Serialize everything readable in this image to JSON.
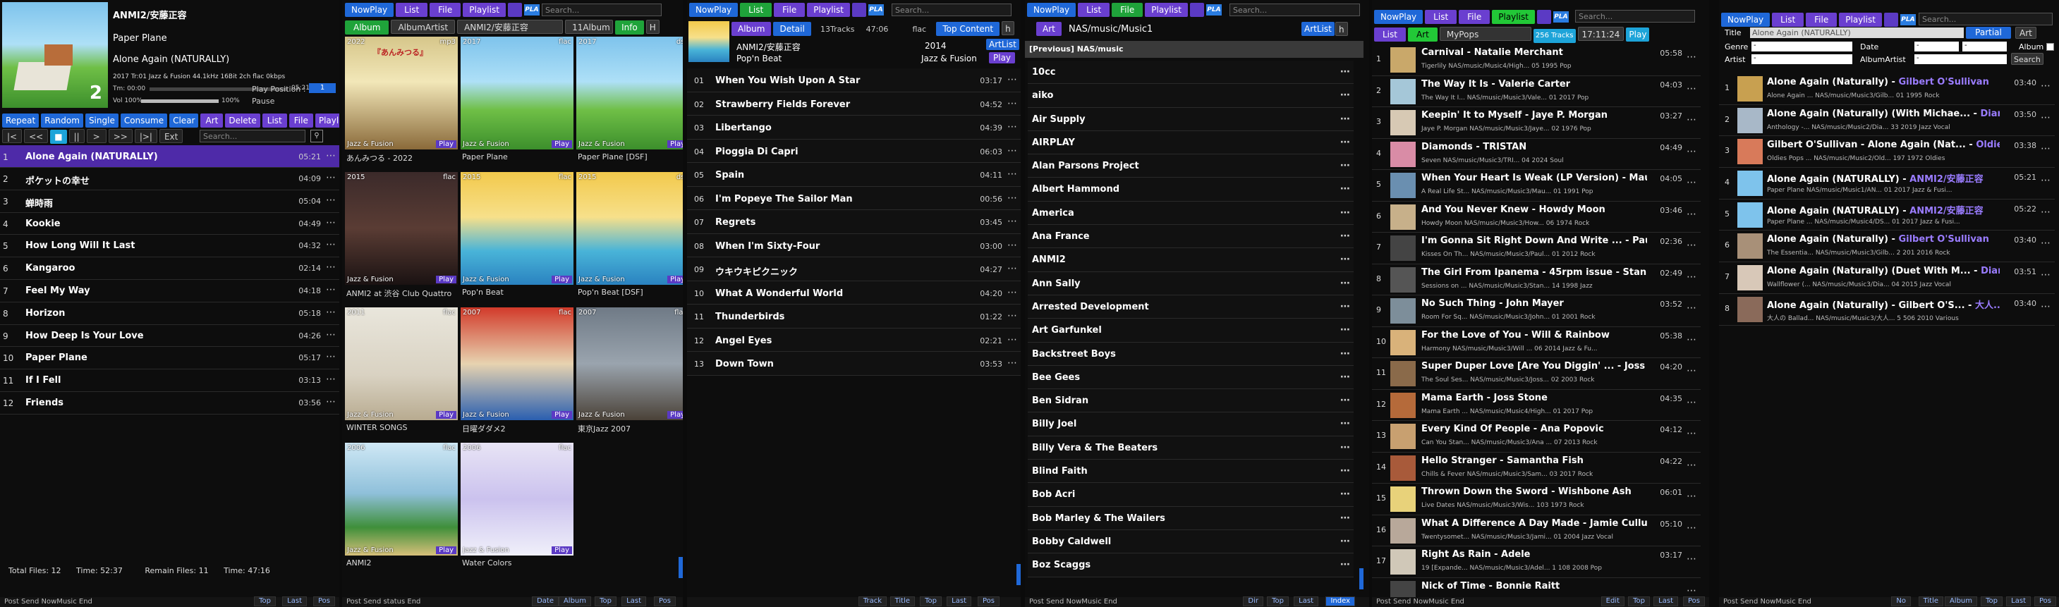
{
  "p1": {
    "now": {
      "artist": "ANMI2/安藤正容",
      "album": "Paper Plane",
      "title": "Alone Again (NATURALLY)",
      "info": "2017 Tr:01 Jazz & Fusion 44.1kHz 16Bit 2ch flac 0kbps",
      "time": "Tm: 00:00",
      "time_total": "05:21",
      "vol": "Vol 100%",
      "vol_pct": "100%",
      "pause": "Pause",
      "play_position_label": "Play Position :",
      "play_position_value": "1",
      "cover_number": "2",
      "progress": 0.0,
      "volume": 1.0
    },
    "mode_buttons": [
      "Repeat",
      "Random",
      "Single",
      "Consume",
      "Clear",
      "Art",
      "Delete",
      "List",
      "File",
      "Playlist"
    ],
    "transport": [
      "|<",
      "<<",
      "■",
      "||",
      ">",
      ">>",
      "|>|",
      "Ext"
    ],
    "search_placeholder": "Search...",
    "queue": [
      {
        "n": "1",
        "t": "Alone Again (NATURALLY)",
        "d": "05:21"
      },
      {
        "n": "2",
        "t": "ポケットの幸せ",
        "d": "04:09"
      },
      {
        "n": "3",
        "t": "蝉時雨",
        "d": "05:04"
      },
      {
        "n": "4",
        "t": "Kookie",
        "d": "04:49"
      },
      {
        "n": "5",
        "t": "How Long Will It Last",
        "d": "04:32"
      },
      {
        "n": "6",
        "t": "Kangaroo",
        "d": "02:14"
      },
      {
        "n": "7",
        "t": "Feel My Way",
        "d": "04:18"
      },
      {
        "n": "8",
        "t": "Horizon",
        "d": "05:18"
      },
      {
        "n": "9",
        "t": "How Deep Is Your Love",
        "d": "04:26"
      },
      {
        "n": "10",
        "t": "Paper Plane",
        "d": "05:17"
      },
      {
        "n": "11",
        "t": "If I Fell",
        "d": "03:13"
      },
      {
        "n": "12",
        "t": "Friends",
        "d": "03:56"
      }
    ],
    "status": {
      "total": "Total  Files:  12",
      "time": "Time:  52:37",
      "remain": "Remain  Files:  11",
      "rtime": "Time:  47:16"
    },
    "footer": {
      "label": "Post Send NowMusic End",
      "tabs": [
        "Top",
        "Last",
        "Pos"
      ]
    }
  },
  "p2": {
    "top_buttons": [
      "NowPlay",
      "List",
      "File",
      "Playlist"
    ],
    "tabs": [
      "Album",
      "AlbumArtist"
    ],
    "path": "ANMI2/安藤正容",
    "count": "11Album",
    "info_btn": "Info",
    "h_btn": "H",
    "search_placeholder": "Search...",
    "cover_text": "『あんみつる』",
    "tiles": [
      {
        "yr": "2022",
        "fmt": "mp3",
        "lbl": "Jazz & Fusion",
        "cap": "あんみつる - 2022"
      },
      {
        "yr": "2017",
        "fmt": "flac",
        "lbl": "Jazz & Fusion",
        "cap": "Paper Plane"
      },
      {
        "yr": "2017",
        "fmt": "dsf",
        "lbl": "Jazz & Fusion",
        "cap": "Paper Plane [DSF]"
      },
      {
        "yr": "2015",
        "fmt": "flac",
        "lbl": "Jazz & Fusion",
        "cap": "ANMI2 at 渋谷 Club Quattro"
      },
      {
        "yr": "2015",
        "fmt": "flac",
        "lbl": "Jazz & Fusion",
        "cap": "Pop'n Beat"
      },
      {
        "yr": "2015",
        "fmt": "dsf",
        "lbl": "Jazz & Fusion",
        "cap": "Pop'n Beat [DSF]"
      },
      {
        "yr": "2011",
        "fmt": "flac",
        "lbl": "Jazz & Fusion",
        "cap": "WINTER SONGS"
      },
      {
        "yr": "2007",
        "fmt": "flac",
        "lbl": "Jazz & Fusion",
        "cap": "日曜ダダメ2"
      },
      {
        "yr": "2007",
        "fmt": "flac",
        "lbl": "Jazz & Fusion",
        "cap": "東京Jazz 2007"
      },
      {
        "yr": "2006",
        "fmt": "flac",
        "lbl": "Jazz & Fusion",
        "cap": "ANMI2"
      },
      {
        "yr": "2006",
        "fmt": "flac",
        "lbl": "Jazz & Fusion",
        "cap": "Water Colors"
      }
    ],
    "play_label": "Play",
    "footer": {
      "label": "Post Send status End",
      "tabs": [
        "Date",
        "Album",
        "Top",
        "Last",
        "Pos"
      ]
    }
  },
  "p3": {
    "top_buttons": [
      "NowPlay",
      "List",
      "File",
      "Playlist"
    ],
    "tabs": [
      "Album",
      "Detail"
    ],
    "tracks": "13Tracks",
    "length": "47:06",
    "fmt": "flac",
    "top_content": "Top Content",
    "h": "h",
    "search_placeholder": "Search...",
    "artist": "ANMI2/安藤正容",
    "year": "2014",
    "album": "Pop'n Beat",
    "genre": "Jazz & Fusion",
    "artlist": "ArtList",
    "play": "Play",
    "list": [
      {
        "n": "01",
        "t": "When You Wish Upon A Star",
        "d": "03:17"
      },
      {
        "n": "02",
        "t": "Strawberry Fields Forever",
        "d": "04:52"
      },
      {
        "n": "03",
        "t": "Libertango",
        "d": "04:39"
      },
      {
        "n": "04",
        "t": "Pioggia Di Capri",
        "d": "06:03"
      },
      {
        "n": "05",
        "t": "Spain",
        "d": "04:11"
      },
      {
        "n": "06",
        "t": "I'm Popeye The Sailor Man",
        "d": "00:56"
      },
      {
        "n": "07",
        "t": "Regrets",
        "d": "03:45"
      },
      {
        "n": "08",
        "t": "When I'm Sixty-Four",
        "d": "03:00"
      },
      {
        "n": "09",
        "t": "ウキウキピクニック",
        "d": "04:27"
      },
      {
        "n": "10",
        "t": "What A Wonderful World",
        "d": "04:20"
      },
      {
        "n": "11",
        "t": "Thunderbirds",
        "d": "01:22"
      },
      {
        "n": "12",
        "t": "Angel Eyes",
        "d": "02:21"
      },
      {
        "n": "13",
        "t": "Down Town",
        "d": "03:53"
      }
    ],
    "footer": {
      "label": "",
      "tabs": [
        "Track",
        "Title",
        "Top",
        "Last",
        "Pos"
      ]
    }
  },
  "p4": {
    "top_buttons": [
      "NowPlay",
      "List",
      "File",
      "Playlist"
    ],
    "art": "Art",
    "path": "NAS/music/Music1",
    "artlist": "ArtList",
    "h": "h",
    "search_placeholder": "Search...",
    "prev": "[Previous] NAS/music",
    "list": [
      "10cc",
      "aiko",
      "Air Supply",
      "AIRPLAY",
      "Alan Parsons Project",
      "Albert Hammond",
      "America",
      "Ana France",
      "ANMI2",
      "Ann Sally",
      "Arrested Development",
      "Art Garfunkel",
      "Backstreet Boys",
      "Bee Gees",
      "Ben Sidran",
      "Billy Joel",
      "Billy Vera & The Beaters",
      "Blind Faith",
      "Bob Acri",
      "Bob Marley & The Wailers",
      "Bobby Caldwell",
      "Boz Scaggs"
    ],
    "footer": {
      "label": "Post Send NowMusic End",
      "tabs": [
        "Dir",
        "Top",
        "Last",
        "Index"
      ]
    }
  },
  "p5": {
    "top_buttons": [
      "NowPlay",
      "List",
      "File",
      "Playlist"
    ],
    "list_btn": "List",
    "art_btn": "Art",
    "name": "MyPops",
    "tracks": "256 Tracks",
    "time": "17:11:24",
    "play": "Play",
    "search_placeholder": "Search...",
    "rows": [
      {
        "n": "1",
        "t": "Carnival - Natalie Merchant",
        "s": "Tigerlily       NAS/music/Music4/High...   05    1995 Pop",
        "d": "05:58"
      },
      {
        "n": "2",
        "t": "The Way It Is - Valerie Carter",
        "s": "The Way It I...   NAS/music/Music3/Vale...   01    2017 Pop",
        "d": "04:03"
      },
      {
        "n": "3",
        "t": "Keepin' It to Myself - Jaye P. Morgan",
        "s": "Jaye P. Morgan   NAS/music/Music3/Jaye...   02    1976 Pop",
        "d": "03:27"
      },
      {
        "n": "4",
        "t": "Diamonds - TRISTAN",
        "s": "Seven       NAS/music/Music3/TRI...   04    2024 Soul",
        "d": "04:49"
      },
      {
        "n": "5",
        "t": "When Your Heart Is Weak (LP Version) - Maura ...",
        "s": "A Real Life St...   NAS/music/Music3/Mau...   01    1991 Pop",
        "d": "04:05"
      },
      {
        "n": "6",
        "t": "And You Never Knew - Howdy Moon",
        "s": "Howdy Moon   NAS/music/Music3/How...   06    1974 Rock",
        "d": "03:46"
      },
      {
        "n": "7",
        "t": "I'm Gonna Sit Right Down And Write ... - Paul ...",
        "s": "Kisses On Th...   NAS/music/Music3/Paul...   01    2012 Rock",
        "d": "02:36"
      },
      {
        "n": "8",
        "t": "The Girl From Ipanema - 45rpm issue - Stan Getz",
        "s": "Sessions on ...   NAS/music/Music3/Stan...   14    1998 Jazz",
        "d": "02:49"
      },
      {
        "n": "9",
        "t": "No Such Thing - John Mayer",
        "s": "Room For Sq...   NAS/music/Music3/John...   01    2001 Rock",
        "d": "03:52"
      },
      {
        "n": "10",
        "t": "For the Love of You - Will & Rainbow",
        "s": "Harmony     NAS/music/Music3/Will ...   06    2014 Jazz & Fu...",
        "d": "05:38"
      },
      {
        "n": "11",
        "t": "Super Duper Love [Are You Diggin' ... - Joss ...",
        "s": "The Soul Ses...   NAS/music/Music3/Joss...   02    2003 Rock",
        "d": "04:20"
      },
      {
        "n": "12",
        "t": "Mama Earth - Joss Stone",
        "s": "Mama Earth ...   NAS/music/Music4/High...   01    2017 Pop",
        "d": "04:35"
      },
      {
        "n": "13",
        "t": "Every Kind Of People - Ana Popovic",
        "s": "Can You Stan...   NAS/music/Music3/Ana ...   07    2013 Rock",
        "d": "04:12"
      },
      {
        "n": "14",
        "t": "Hello Stranger - Samantha Fish",
        "s": "Chills & Fever   NAS/music/Music3/Sam...   03    2017 Rock",
        "d": "04:22"
      },
      {
        "n": "15",
        "t": "Thrown Down the Sword - Wishbone Ash",
        "s": "Live Dates     NAS/music/Music3/Wis...   103   1973 Rock",
        "d": "06:01"
      },
      {
        "n": "16",
        "t": "What A Difference A Day Made - Jamie Cullum",
        "s": "Twentysomet...   NAS/music/Music3/Jami...   01    2004 Jazz Vocal",
        "d": "05:10"
      },
      {
        "n": "17",
        "t": "Right As Rain - Adele",
        "s": "19 [Expande...   NAS/music/Music3/Adel...   1 108 2008 Pop",
        "d": "03:17"
      },
      {
        "n": "",
        "t": "Nick of Time - Bonnie Raitt",
        "s": "",
        "d": ""
      }
    ],
    "footer": {
      "label": "Post Send NowMusic End",
      "tabs": [
        "Edit",
        "Top",
        "Last",
        "Pos"
      ]
    }
  },
  "p6": {
    "top_buttons": [
      "NowPlay",
      "List",
      "File",
      "Playlist"
    ],
    "search_placeholder": "Search...",
    "form": {
      "title_lbl": "Title",
      "title_val": "Alone Again (NATURALLY)",
      "partial": "Partial",
      "art": "Art",
      "genre_lbl": "Genre",
      "date_lbl": "Date",
      "album_lbl": "Album",
      "artist_lbl": "Artist",
      "albumartist_lbl": "AlbumArtist",
      "search_btn": "Search",
      "dash": "-"
    },
    "rows": [
      {
        "n": "1",
        "t": "Alone Again (Naturally) - ",
        "ar": "Gilbert O'Sullivan",
        "s": "Alone Again ...   NAS/music/Music3/Gilb...   01    1995 Rock",
        "d": "03:40"
      },
      {
        "n": "2",
        "t": "Alone Again (Naturally) (With Michae... - ",
        "ar": "Diana...",
        "s": "Anthology -...   NAS/music/Music2/Dia...   33    2019 Jazz Vocal",
        "d": "03:50"
      },
      {
        "n": "3",
        "t": "Gilbert O'Sullivan - Alone Again (Nat... - ",
        "ar": "Oldie...",
        "s": "Oldies Pops ...   NAS/music/Music2/Old...   197   1972 Oldies",
        "d": "03:38"
      },
      {
        "n": "4",
        "t": "Alone Again (NATURALLY) - ",
        "ar": "ANMI2/安藤正容",
        "s": "Paper Plane     NAS/music/Music1/AN...   01    2017 Jazz & Fusi...",
        "d": "05:21"
      },
      {
        "n": "5",
        "t": "Alone Again (NATURALLY) - ",
        "ar": "ANMI2/安藤正容",
        "s": "Paper Plane ...   NAS/music/Music4/DS...   01    2017 Jazz & Fusi...",
        "d": "05:22"
      },
      {
        "n": "6",
        "t": "Alone Again (Naturally) - ",
        "ar": "Gilbert O'Sullivan",
        "s": "The Essentia...   NAS/music/Music3/Gilb...   2 201 2016 Rock",
        "d": "03:40"
      },
      {
        "n": "7",
        "t": "Alone Again (Naturally) (Duet With M... - ",
        "ar": "Diana...",
        "s": "Wallflower (...   NAS/music/Music3/Dia...   04    2015 Jazz Vocal",
        "d": "03:51"
      },
      {
        "n": "8",
        "t": "Alone Again (Naturally) - Gilbert O'S... - ",
        "ar": "大人...",
        "s": "大人の Ballad...   NAS/music/Music3/大人...   5 506 2010 Various",
        "d": "03:40"
      }
    ],
    "footer": {
      "label": "Post Send NowMusic End",
      "tabs": [
        "No",
        "Title",
        "Album",
        "Top",
        "Last",
        "Pos"
      ]
    }
  }
}
